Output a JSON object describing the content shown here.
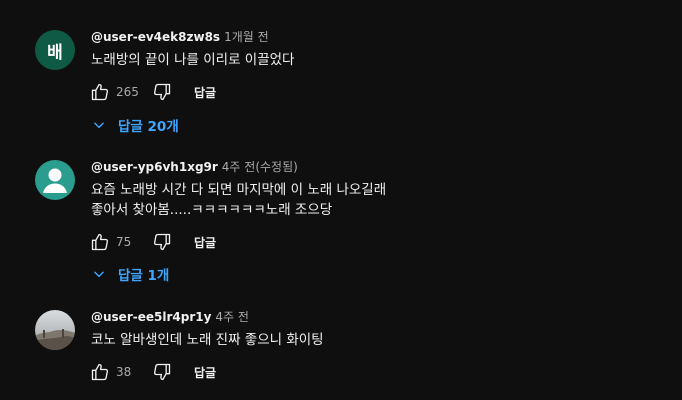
{
  "comments": [
    {
      "author": "@user-ev4ek8zw8s",
      "time": "1개월 전",
      "avatar_letter": "배",
      "avatar_color": "#0f5a45",
      "text": "노래방의 끝이 나를 이리로 이끌었다",
      "likes": "265",
      "reply_label": "답글",
      "replies_label": "답글 20개"
    },
    {
      "author": "@user-yp6vh1xg9r",
      "time": "4주 전(수정됨)",
      "avatar_color": "#2a9d8f",
      "text": "요즘 노래방 시간 다 되면 마지막에 이 노래 나오길래\n좋아서 찾아봄.....ㅋㅋㅋㅋㅋㅋ노래 조으당",
      "likes": "75",
      "reply_label": "답글",
      "replies_label": "답글 1개"
    },
    {
      "author": "@user-ee5lr4pr1y",
      "time": "4주 전",
      "text": "코노 알바생인데 노래 진짜 좋으니 화이팅",
      "likes": "38",
      "reply_label": "답글"
    }
  ],
  "colors": {
    "background": "#0f0f0f",
    "link_blue": "#3ea6ff",
    "secondary_text": "#aaaaaa"
  },
  "icons": [
    "thumb-up-icon",
    "thumb-down-icon",
    "chevron-down-icon",
    "person-icon"
  ]
}
